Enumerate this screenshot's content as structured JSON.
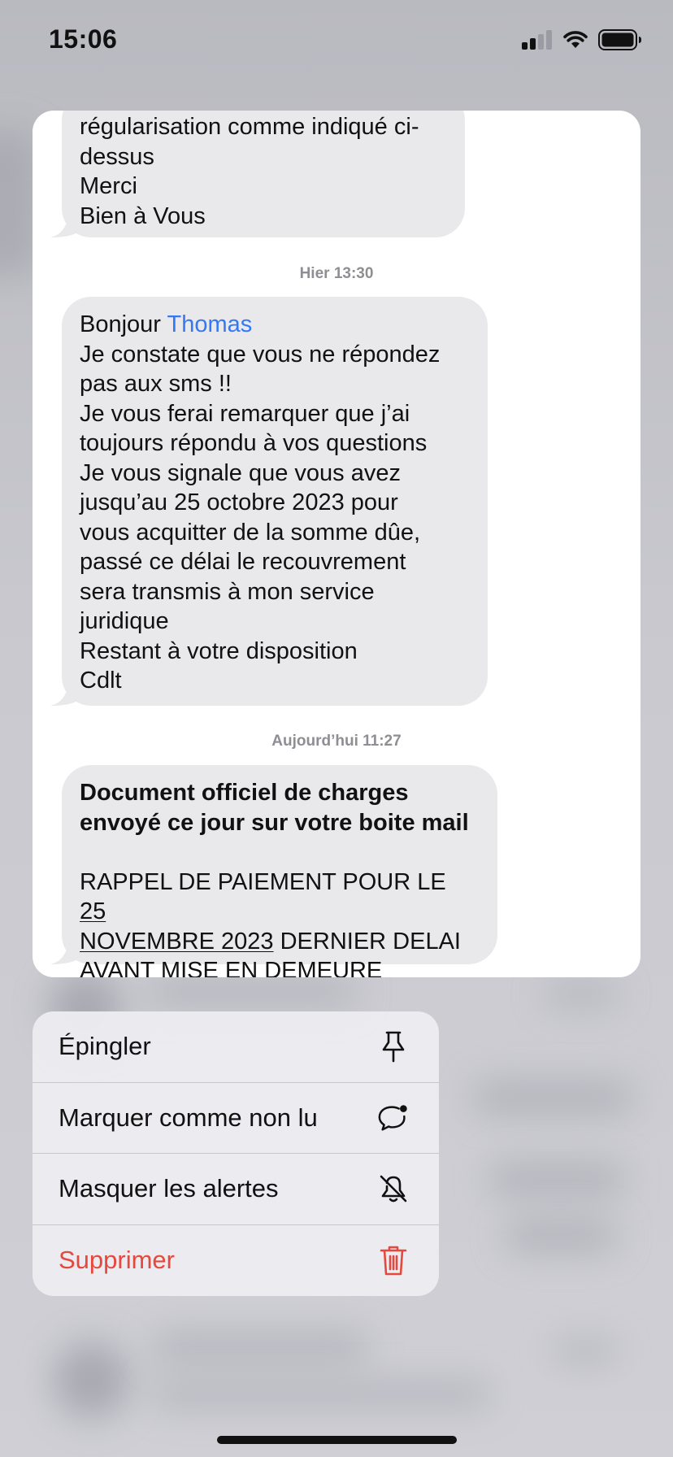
{
  "status_bar": {
    "time": "15:06",
    "signal_icon": "cellular-signal-icon",
    "wifi_icon": "wifi-icon",
    "battery_icon": "battery-icon"
  },
  "preview": {
    "messages": [
      {
        "lines": [
          "régularisation comme indiqué ci-",
          "dessus",
          "Merci",
          "Bien à Vous"
        ]
      },
      {
        "timestamp": "Hier 13:30",
        "greeting": "Bonjour ",
        "mention": "Thomas",
        "body": "Je constate que vous ne répondez\npas aux sms !!\nJe vous ferai remarquer que j’ai\ntoujours répondu à vos questions\nJe vous signale que vous avez\njusqu’au 25 octobre 2023 pour\nvous acquitter de la somme dûe,\npassé ce délai le recouvrement\nsera transmis à mon service\njuridique\nRestant à votre disposition\nCdlt"
      },
      {
        "timestamp": "Aujourd’hui 11:27",
        "bold_line_1": "Document officiel de charges",
        "bold_line_2": "envoyé ce jour sur votre boite mail",
        "reminder_prefix": "RAPPEL DE PAIEMENT POUR LE ",
        "date_part_1": "25",
        "date_part_2": "NOVEMBRE 2023",
        "reminder_suffix": " DERNIER DELAI",
        "reminder_last": "AVANT MISE EN DEMEURE"
      }
    ]
  },
  "menu": {
    "items": [
      {
        "label": "Épingler",
        "icon": "pin-icon"
      },
      {
        "label": "Marquer comme non lu",
        "icon": "unread-bubble-icon"
      },
      {
        "label": "Masquer les alertes",
        "icon": "bell-slash-icon"
      },
      {
        "label": "Supprimer",
        "icon": "trash-icon",
        "destructive": true
      }
    ]
  },
  "colors": {
    "accent": "#3478f6",
    "destructive": "#e5483c",
    "bubble": "#e9e9eb",
    "timestamp": "#8e8e93"
  }
}
